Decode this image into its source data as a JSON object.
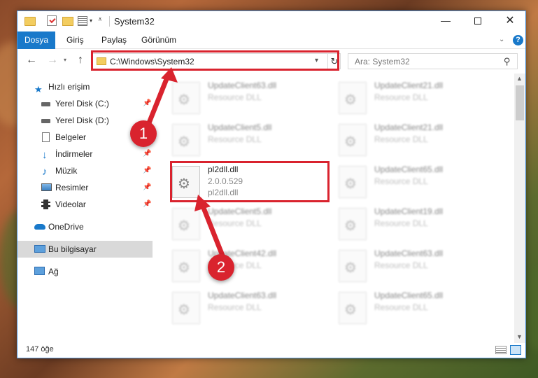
{
  "window": {
    "title": "System32",
    "minimize_glyph": "—",
    "close_glyph": "✕"
  },
  "quick_access_toolbar": {
    "icons": [
      "folder-icon",
      "properties-icon",
      "new-folder-icon",
      "view-icon",
      "customize-dropdown-icon"
    ]
  },
  "ribbon": {
    "tabs": [
      {
        "label": "Dosya",
        "active": true
      },
      {
        "label": "Giriş"
      },
      {
        "label": "Paylaş"
      },
      {
        "label": "Görünüm"
      }
    ],
    "help_glyph": "?"
  },
  "address_bar": {
    "path": "C:\\Windows\\System32",
    "search_placeholder": "Ara: System32"
  },
  "sidebar": {
    "items": [
      {
        "label": "Hızlı erişim",
        "icon": "star-icon",
        "pinned": false
      },
      {
        "label": "Yerel Disk (C:)",
        "icon": "drive-icon",
        "pinned": true
      },
      {
        "label": "Yerel Disk (D:)",
        "icon": "drive-icon",
        "pinned": false
      },
      {
        "label": "Belgeler",
        "icon": "documents-icon",
        "pinned": true
      },
      {
        "label": "İndirmeler",
        "icon": "download-icon",
        "pinned": true
      },
      {
        "label": "Müzik",
        "icon": "music-icon",
        "pinned": true
      },
      {
        "label": "Resimler",
        "icon": "pictures-icon",
        "pinned": true
      },
      {
        "label": "Videolar",
        "icon": "videos-icon",
        "pinned": true
      },
      {
        "label": "OneDrive",
        "icon": "cloud-icon",
        "pinned": false
      },
      {
        "label": "Bu bilgisayar",
        "icon": "computer-icon",
        "selected": true
      },
      {
        "label": "Ağ",
        "icon": "network-icon",
        "pinned": false
      }
    ]
  },
  "files": {
    "featured": {
      "name": "pl2dll.dll",
      "version": "2.0.0.529",
      "description": "pl2dll.dll"
    },
    "left_column": [
      {
        "name": "UpdateClient63.dll",
        "type": "Resource DLL"
      },
      {
        "name": "UpdateClient5.dll",
        "type": "Resource DLL"
      },
      {
        "name": "UpdateClient5.dll",
        "type": "Resource DLL"
      },
      {
        "name": "UpdateClient42.dll",
        "type": "Resource DLL"
      },
      {
        "name": "UpdateClient63.dll",
        "type": "Resource DLL"
      }
    ],
    "right_column": [
      {
        "name": "UpdateClient21.dll",
        "type": "Resource DLL"
      },
      {
        "name": "UpdateClient21.dll",
        "type": "Resource DLL"
      },
      {
        "name": "UpdateClient65.dll",
        "type": "Resource DLL"
      },
      {
        "name": "UpdateClient19.dll",
        "type": "Resource DLL"
      },
      {
        "name": "UpdateClient63.dll",
        "type": "Resource DLL"
      },
      {
        "name": "UpdateClient65.dll",
        "type": "Resource DLL"
      }
    ]
  },
  "status_bar": {
    "item_count": "147 öğe"
  },
  "annotations": {
    "callout_1": "1",
    "callout_2": "2",
    "color": "#d9232e"
  }
}
